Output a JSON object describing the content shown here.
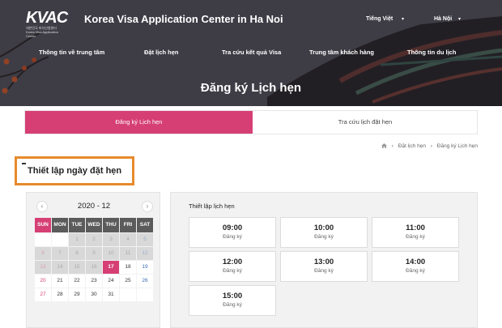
{
  "brand": {
    "logo_text": "KVAC",
    "logo_sub_1": "대한민국 비자신청센터",
    "logo_sub_2": "Korea Visa Application Center",
    "site_title": "Korea Visa Application Center in Ha Noi"
  },
  "header": {
    "language": "Tiếng Việt",
    "city": "Hà Nội",
    "nav": [
      "Thông tin về trung tâm",
      "Đặt lịch hẹn",
      "Tra cứu kết quả Visa",
      "Trung tâm khách hàng",
      "Thông tin du lịch"
    ],
    "page_heading": "Đăng ký Lịch hẹn"
  },
  "tabs": [
    {
      "label": "Đăng ký Lịch hẹn",
      "active": true
    },
    {
      "label": "Tra cứu lịch đặt hẹn",
      "active": false
    }
  ],
  "breadcrumb": [
    "Đặt lịch hẹn",
    "Đăng ký Lịch hẹn"
  ],
  "section_title": "Thiết lập ngày đặt hẹn",
  "calendar": {
    "month_label": "2020 - 12",
    "prev": "‹",
    "next": "›",
    "weekdays": [
      "SUN",
      "MON",
      "TUE",
      "WED",
      "THU",
      "FRI",
      "SAT"
    ],
    "weeks": [
      [
        {
          "d": ""
        },
        {
          "d": ""
        },
        {
          "d": "1",
          "off": true
        },
        {
          "d": "2",
          "off": true
        },
        {
          "d": "3",
          "off": true
        },
        {
          "d": "4",
          "off": true
        },
        {
          "d": "5",
          "off": true
        }
      ],
      [
        {
          "d": "6",
          "off": true
        },
        {
          "d": "7",
          "off": true
        },
        {
          "d": "8",
          "off": true
        },
        {
          "d": "9",
          "off": true
        },
        {
          "d": "10",
          "off": true
        },
        {
          "d": "11",
          "off": true
        },
        {
          "d": "12",
          "off": true
        }
      ],
      [
        {
          "d": "13",
          "off": true
        },
        {
          "d": "14",
          "off": true
        },
        {
          "d": "15",
          "off": true
        },
        {
          "d": "16",
          "off": true
        },
        {
          "d": "17",
          "today": true
        },
        {
          "d": "18"
        },
        {
          "d": "19"
        }
      ],
      [
        {
          "d": "20"
        },
        {
          "d": "21"
        },
        {
          "d": "22"
        },
        {
          "d": "23"
        },
        {
          "d": "24"
        },
        {
          "d": "25"
        },
        {
          "d": "26"
        }
      ],
      [
        {
          "d": "27"
        },
        {
          "d": "28"
        },
        {
          "d": "29"
        },
        {
          "d": "30"
        },
        {
          "d": "31"
        },
        {
          "d": ""
        },
        {
          "d": ""
        }
      ]
    ]
  },
  "time_slots": {
    "title": "Thiết lập lịch hẹn",
    "action_label": "Đăng ký",
    "times": [
      "09:00",
      "10:00",
      "11:00",
      "12:00",
      "13:00",
      "14:00",
      "15:00"
    ]
  },
  "colors": {
    "accent": "#d63f74",
    "highlight_border": "#e78a2c",
    "weekday_header": "#5b5b5b"
  }
}
